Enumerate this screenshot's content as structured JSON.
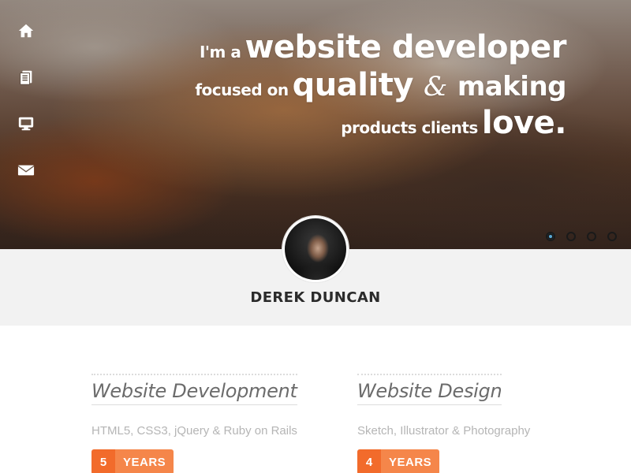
{
  "hero": {
    "tagline": {
      "line1_small": "I'm a",
      "line1_large": "website developer",
      "line2_small": "focused on",
      "line2_large": "quality",
      "line2_amp": "&",
      "line2_tail": "making",
      "line3_small": "products clients",
      "line3_large": "love."
    },
    "nav": [
      "home-icon",
      "documents-icon",
      "monitor-icon",
      "mail-icon"
    ],
    "slider": {
      "count": 4,
      "active": 1
    }
  },
  "profile": {
    "name": "DEREK DUNCAN"
  },
  "skills": [
    {
      "title": "Website Development",
      "tech": "HTML5,  CSS3,  jQuery & Ruby on Rails",
      "years": "5",
      "years_label": "YEARS"
    },
    {
      "title": "Website Design",
      "tech": "Sketch, Illustrator & Photography",
      "years": "4",
      "years_label": "YEARS"
    }
  ],
  "colors": {
    "accent": "#f26b2b",
    "accent_light": "#f5864a",
    "band": "#f2f2f2",
    "active_dot": "#59a9d6"
  }
}
